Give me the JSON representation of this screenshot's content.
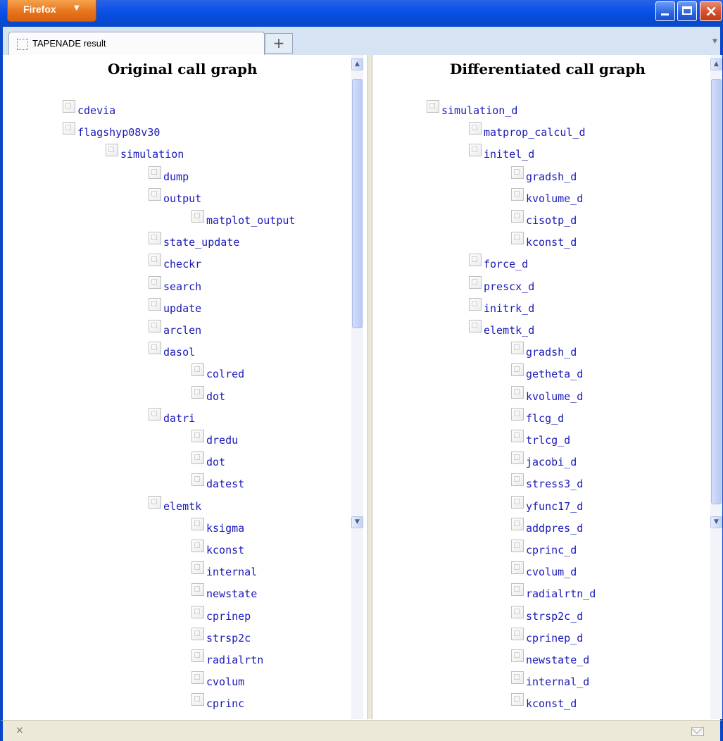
{
  "titlebar": {
    "app_button_label": "Firefox",
    "app_button_arrow": "▼",
    "close_glyph": "×"
  },
  "tabs": [
    {
      "label": "TAPENADE result"
    }
  ],
  "new_tab_label": "+",
  "all_tabs_glyph": "▼",
  "left_pane": {
    "title": "Original call graph",
    "nodes": [
      {
        "depth": 0,
        "label": "cdevia"
      },
      {
        "depth": 0,
        "label": "flagshyp08v30"
      },
      {
        "depth": 1,
        "label": "simulation"
      },
      {
        "depth": 2,
        "label": "dump"
      },
      {
        "depth": 2,
        "label": "output"
      },
      {
        "depth": 3,
        "label": "matplot_output"
      },
      {
        "depth": 2,
        "label": "state_update"
      },
      {
        "depth": 2,
        "label": "checkr"
      },
      {
        "depth": 2,
        "label": "search"
      },
      {
        "depth": 2,
        "label": "update"
      },
      {
        "depth": 2,
        "label": "arclen"
      },
      {
        "depth": 2,
        "label": "dasol"
      },
      {
        "depth": 3,
        "label": "colred"
      },
      {
        "depth": 3,
        "label": "dot"
      },
      {
        "depth": 2,
        "label": "datri"
      },
      {
        "depth": 3,
        "label": "dredu"
      },
      {
        "depth": 3,
        "label": "dot"
      },
      {
        "depth": 3,
        "label": "datest"
      },
      {
        "depth": 2,
        "label": "elemtk"
      },
      {
        "depth": 3,
        "label": "ksigma"
      },
      {
        "depth": 3,
        "label": "kconst"
      },
      {
        "depth": 3,
        "label": "internal"
      },
      {
        "depth": 3,
        "label": "newstate"
      },
      {
        "depth": 3,
        "label": "cprinep"
      },
      {
        "depth": 3,
        "label": "strsp2c"
      },
      {
        "depth": 3,
        "label": "radialrtn"
      },
      {
        "depth": 3,
        "label": "cvolum"
      },
      {
        "depth": 3,
        "label": "cprinc"
      }
    ]
  },
  "right_pane": {
    "title": "Differentiated call graph",
    "nodes": [
      {
        "depth": 0,
        "label": "simulation_d"
      },
      {
        "depth": 1,
        "label": "matprop_calcul_d"
      },
      {
        "depth": 1,
        "label": "initel_d"
      },
      {
        "depth": 2,
        "label": "gradsh_d"
      },
      {
        "depth": 2,
        "label": "kvolume_d"
      },
      {
        "depth": 2,
        "label": "cisotp_d"
      },
      {
        "depth": 2,
        "label": "kconst_d"
      },
      {
        "depth": 1,
        "label": "force_d"
      },
      {
        "depth": 1,
        "label": "prescx_d"
      },
      {
        "depth": 1,
        "label": "initrk_d"
      },
      {
        "depth": 1,
        "label": "elemtk_d"
      },
      {
        "depth": 2,
        "label": "gradsh_d"
      },
      {
        "depth": 2,
        "label": "getheta_d"
      },
      {
        "depth": 2,
        "label": "kvolume_d"
      },
      {
        "depth": 2,
        "label": "flcg_d"
      },
      {
        "depth": 2,
        "label": "trlcg_d"
      },
      {
        "depth": 2,
        "label": "jacobi_d"
      },
      {
        "depth": 2,
        "label": "stress3_d"
      },
      {
        "depth": 2,
        "label": "yfunc17_d"
      },
      {
        "depth": 2,
        "label": "addpres_d"
      },
      {
        "depth": 2,
        "label": "cprinc_d"
      },
      {
        "depth": 2,
        "label": "cvolum_d"
      },
      {
        "depth": 2,
        "label": "radialrtn_d"
      },
      {
        "depth": 2,
        "label": "strsp2c_d"
      },
      {
        "depth": 2,
        "label": "cprinep_d"
      },
      {
        "depth": 2,
        "label": "newstate_d"
      },
      {
        "depth": 2,
        "label": "internal_d"
      },
      {
        "depth": 2,
        "label": "kconst_d"
      }
    ]
  },
  "statusbar": {
    "close_glyph": "×"
  },
  "colors": {
    "link": "#1a1ab8",
    "titlebar": "#0a52e8",
    "firefox_button": "#e8741c"
  }
}
